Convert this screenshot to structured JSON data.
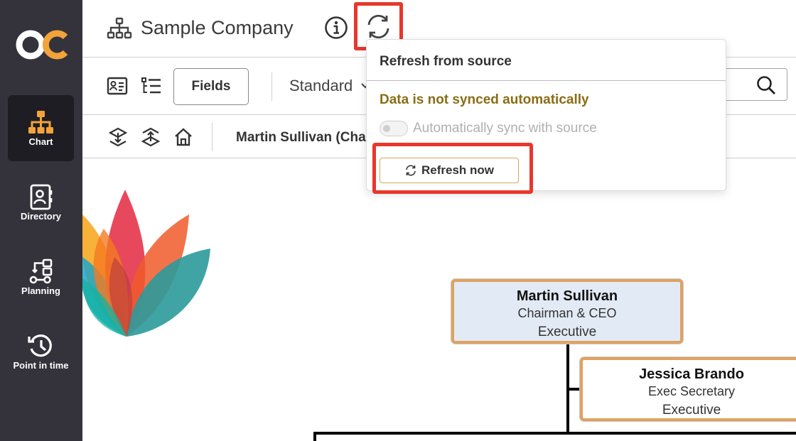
{
  "sidebar": {
    "logo_text": "OC",
    "items": [
      {
        "label": "Chart",
        "icon": "org-chart-icon",
        "active": true
      },
      {
        "label": "Directory",
        "icon": "directory-icon",
        "active": false
      },
      {
        "label": "Planning",
        "icon": "planning-icon",
        "active": false
      },
      {
        "label": "Point in time",
        "icon": "history-icon",
        "active": false
      }
    ]
  },
  "header": {
    "title": "Sample Company"
  },
  "toolbar": {
    "fields_label": "Fields",
    "view_mode": "Standard"
  },
  "breadcrumb": {
    "current": "Martin Sullivan (Cha"
  },
  "popup": {
    "title": "Refresh from source",
    "warning": "Data is not synced automatically",
    "auto_sync_label": "Automatically sync with source",
    "auto_sync_enabled": false,
    "refresh_now_label": "Refresh now"
  },
  "org_chart": {
    "nodes": [
      {
        "name": "Martin Sullivan",
        "title": "Chairman & CEO",
        "department": "Executive"
      },
      {
        "name": "Jessica Brando",
        "title": "Exec Secretary",
        "department": "Executive"
      }
    ]
  },
  "colors": {
    "sidebar_bg": "#34333b",
    "sidebar_active": "#1e1d23",
    "accent_orange": "#f2a33a",
    "highlight_red": "#e8372c",
    "warning_text": "#8a6d16",
    "card_border": "#e0a260",
    "ceo_card_bg": "#e2ebf5"
  }
}
